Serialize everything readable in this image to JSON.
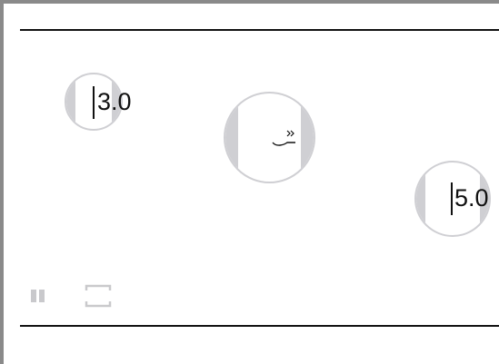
{
  "controls": {
    "dial_left": {
      "value": "3.0"
    },
    "dial_center": {
      "icon": "double-chevron-arrow-icon"
    },
    "dial_right": {
      "value": "5.0"
    }
  },
  "toolbar": {
    "pause_icon": "pause-icon",
    "fullscreen_icon": "fullscreen-icon"
  },
  "colors": {
    "ring": "#cfcfd3",
    "text": "#111111",
    "frame": "#8a8a8a"
  }
}
